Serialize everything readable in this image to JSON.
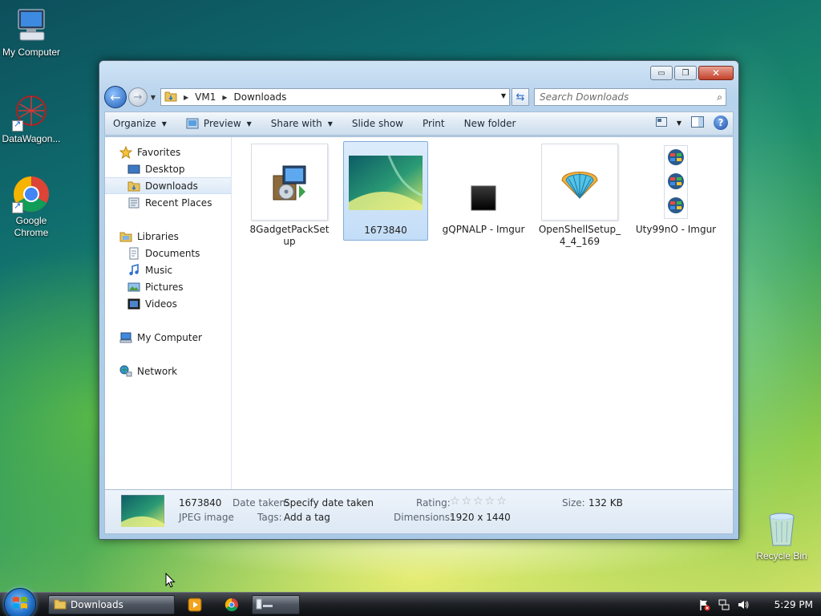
{
  "desktop": {
    "icons": [
      {
        "label": "My Computer"
      },
      {
        "label": "DataWagon..."
      },
      {
        "label": "Google Chrome"
      },
      {
        "label": "Recycle Bin"
      }
    ]
  },
  "window": {
    "caption_buttons": {
      "minimize": "▭",
      "maximize": "❐",
      "close": "✕"
    },
    "address": {
      "crumbs": [
        "VM1",
        "Downloads"
      ]
    },
    "search": {
      "placeholder": "Search Downloads"
    },
    "toolbar": {
      "organize": "Organize",
      "preview": "Preview",
      "share_with": "Share with",
      "slide_show": "Slide show",
      "print": "Print",
      "new_folder": "New folder"
    },
    "navpane": {
      "favorites": "Favorites",
      "desktop": "Desktop",
      "downloads": "Downloads",
      "recent_places": "Recent Places",
      "libraries": "Libraries",
      "documents": "Documents",
      "music": "Music",
      "pictures": "Pictures",
      "videos": "Videos",
      "my_computer": "My Computer",
      "network": "Network"
    },
    "files": [
      {
        "name": "8GadgetPackSetup"
      },
      {
        "name": "1673840"
      },
      {
        "name": "gQPNALP - Imgur"
      },
      {
        "name": "OpenShellSetup_4_4_169"
      },
      {
        "name": "Uty99nO - Imgur"
      }
    ],
    "details": {
      "file_name": "1673840",
      "file_type": "JPEG image",
      "date_taken_label": "Date taken:",
      "date_taken_value": "Specify date taken",
      "tags_label": "Tags:",
      "tags_value": "Add a tag",
      "rating_label": "Rating:",
      "rating_stars": "☆☆☆☆☆",
      "dimensions_label": "Dimensions:",
      "dimensions_value": "1920 x 1440",
      "size_label": "Size:",
      "size_value": "132 KB"
    }
  },
  "taskbar": {
    "active_task": "Downloads",
    "clock": "5:29 PM"
  },
  "colors": {
    "selection": "#c4ddf7",
    "taskbar": "#1d2024",
    "accent": "#1f6fc7"
  }
}
